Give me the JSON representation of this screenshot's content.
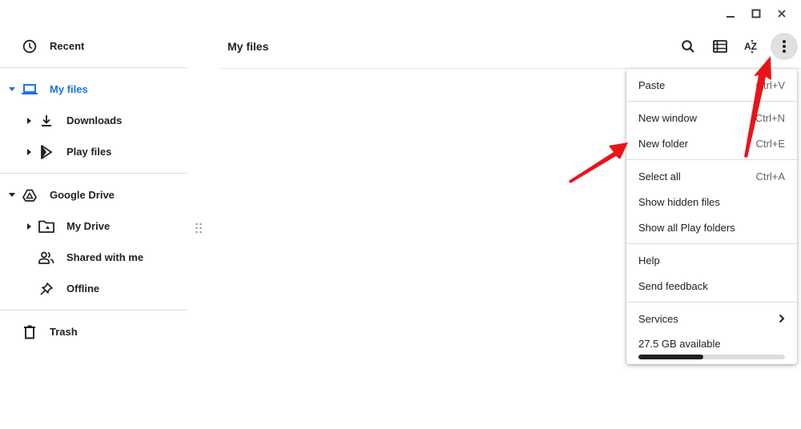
{
  "window_controls": {
    "minimize": "minimize-icon",
    "maximize": "maximize-icon",
    "close": "close-icon"
  },
  "sidebar": {
    "items": [
      {
        "label": "Recent",
        "icon": "clock-icon"
      },
      {
        "label": "My files",
        "icon": "laptop-icon",
        "selected": true,
        "expanded": true
      },
      {
        "label": "Downloads",
        "icon": "download-icon"
      },
      {
        "label": "Play files",
        "icon": "play-store-icon"
      },
      {
        "label": "Google Drive",
        "icon": "drive-icon",
        "expanded": true
      },
      {
        "label": "My Drive",
        "icon": "drive-folder-icon"
      },
      {
        "label": "Shared with me",
        "icon": "people-icon"
      },
      {
        "label": "Offline",
        "icon": "pin-icon"
      },
      {
        "label": "Trash",
        "icon": "trash-icon"
      }
    ]
  },
  "header": {
    "title": "My files",
    "toolbar": [
      "search-icon",
      "list-view-icon",
      "sort-az-icon",
      "more-vert-icon"
    ]
  },
  "menu": {
    "items": [
      {
        "label": "Paste",
        "shortcut": "Ctrl+V"
      },
      {
        "label": "New window",
        "shortcut": "Ctrl+N"
      },
      {
        "label": "New folder",
        "shortcut": "Ctrl+E"
      },
      {
        "label": "Select all",
        "shortcut": "Ctrl+A"
      },
      {
        "label": "Show hidden files",
        "shortcut": ""
      },
      {
        "label": "Show all Play folders",
        "shortcut": ""
      },
      {
        "label": "Help",
        "shortcut": ""
      },
      {
        "label": "Send feedback",
        "shortcut": ""
      },
      {
        "label": "Services",
        "shortcut": ""
      }
    ],
    "storage": {
      "label": "27.5 GB available",
      "used_fraction": 0.44
    }
  },
  "colors": {
    "accent": "#1a73e8",
    "selected_bg": "#e8f0fe",
    "annotation_arrow": "#e8141a"
  }
}
